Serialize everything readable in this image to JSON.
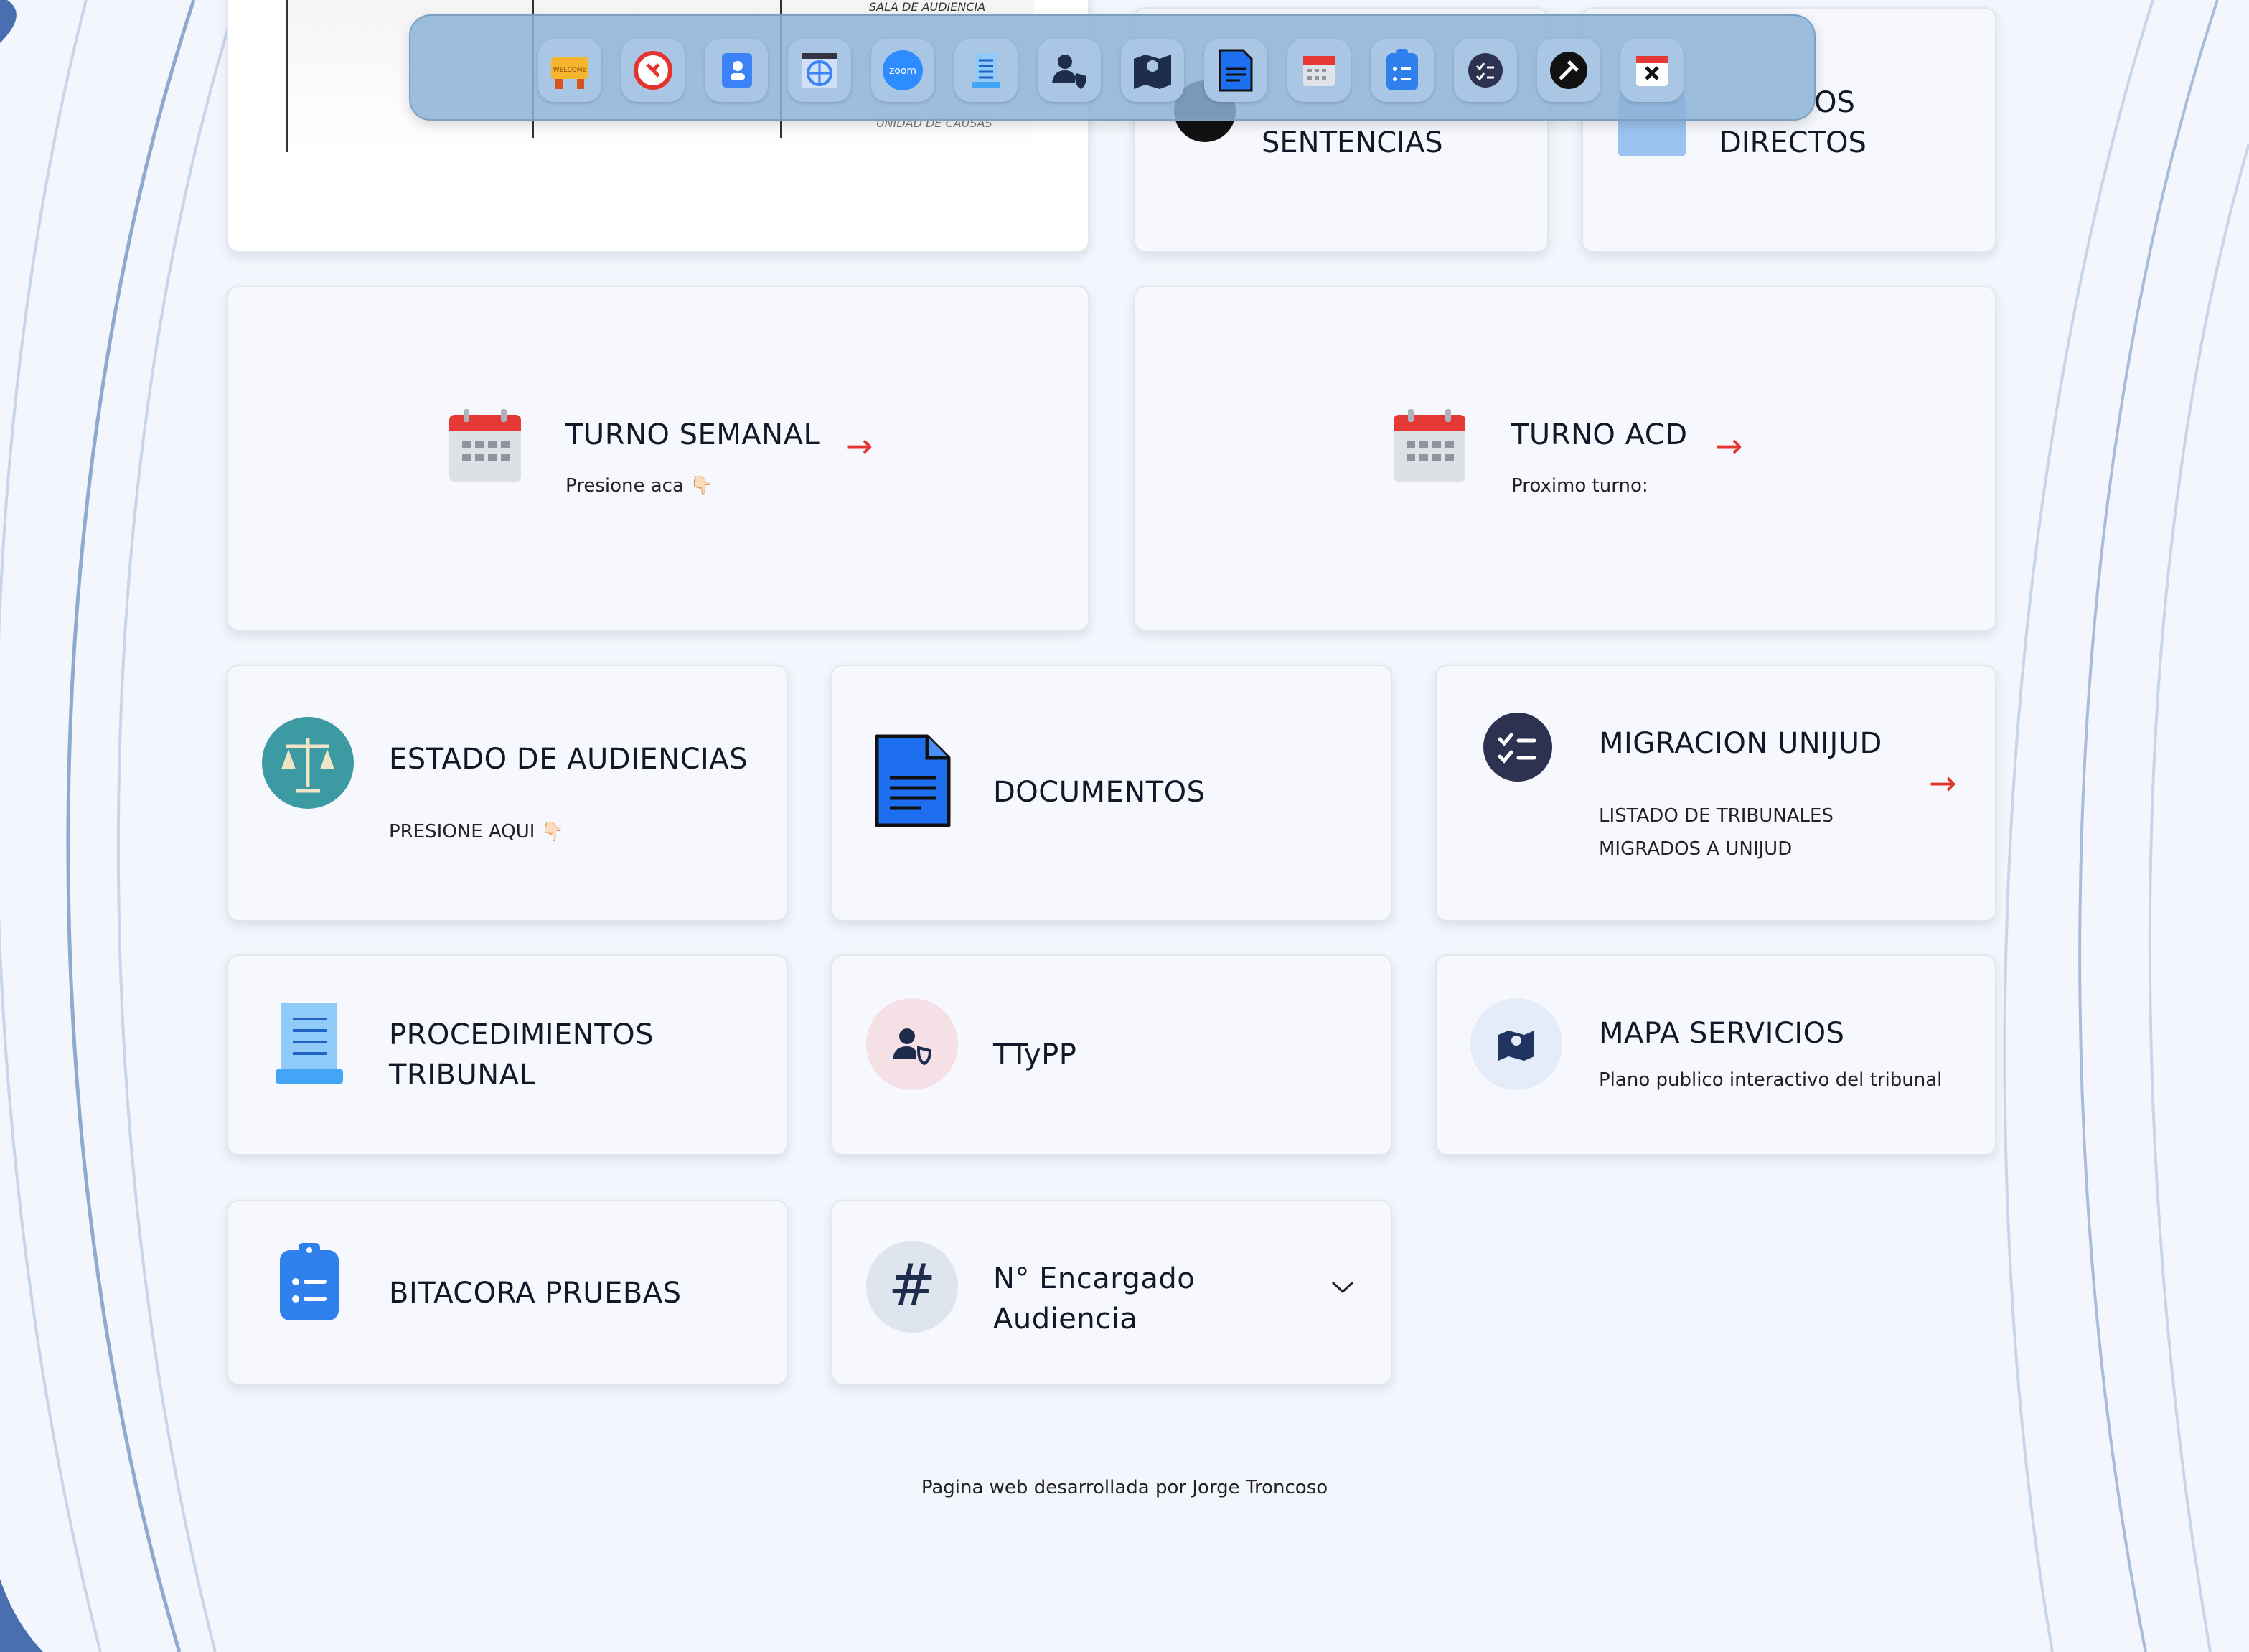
{
  "colors": {
    "accent": "#e3342f",
    "card_bg": "#f6f8fd",
    "page_bg": "#f3f6fc",
    "dock_bg": "#8cb2d6"
  },
  "top_cards": {
    "preview_text_1": "SALA DE AUDIENCIA",
    "preview_text_2": "UNIDAD DE CAUSAS",
    "sentencias_title": "SENTENCIAS",
    "directos_title_1": "OS",
    "directos_title_2": "DIRECTOS"
  },
  "dock": {
    "items": [
      {
        "name": "welcome-icon",
        "label": "WELCOME"
      },
      {
        "name": "refresh-icon",
        "label": ""
      },
      {
        "name": "contacts-icon",
        "label": ""
      },
      {
        "name": "web-icon",
        "label": ""
      },
      {
        "name": "zoom-icon",
        "label": "zoom"
      },
      {
        "name": "document-list-icon",
        "label": ""
      },
      {
        "name": "user-shield-icon",
        "label": ""
      },
      {
        "name": "map-icon",
        "label": ""
      },
      {
        "name": "document-icon",
        "label": ""
      },
      {
        "name": "calendar-icon",
        "label": ""
      },
      {
        "name": "clipboard-icon",
        "label": ""
      },
      {
        "name": "checklist-icon",
        "label": ""
      },
      {
        "name": "gavel-icon",
        "label": ""
      },
      {
        "name": "close-calendar-icon",
        "label": ""
      }
    ]
  },
  "cards": {
    "turno_semanal": {
      "title": "TURNO SEMANAL",
      "subtitle": "Presione aca 👇🏻"
    },
    "turno_acd": {
      "title": "TURNO ACD",
      "subtitle": "Proximo turno:"
    },
    "estado_audiencias": {
      "title": "ESTADO DE AUDIENCIAS",
      "subtitle": "PRESIONE AQUI 👇🏻"
    },
    "documentos": {
      "title": "DOCUMENTOS"
    },
    "migracion": {
      "title": "MIGRACION UNIJUD",
      "subtitle_1": "LISTADO DE TRIBUNALES",
      "subtitle_2": "MIGRADOS A UNIJUD"
    },
    "procedimientos": {
      "title_1": "PROCEDIMIENTOS",
      "title_2": "TRIBUNAL"
    },
    "ttypp": {
      "title": "TTyPP"
    },
    "mapa": {
      "title": "MAPA SERVICIOS",
      "subtitle": "Plano publico interactivo del tribunal"
    },
    "bitacora": {
      "title": "BITACORA PRUEBAS"
    },
    "encargado": {
      "title_1": "N° Encargado",
      "title_2": "Audiencia"
    }
  },
  "footer": "Pagina web desarrollada por Jorge Troncoso"
}
